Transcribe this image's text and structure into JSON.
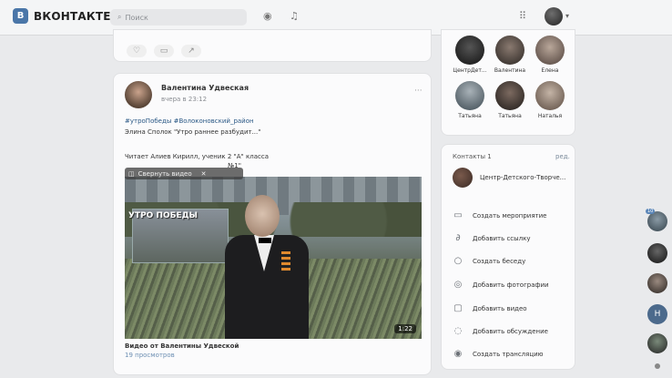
{
  "header": {
    "logo_text": "ВКОНТАКТЕ",
    "logo_mark": "В",
    "search_placeholder": "Поиск"
  },
  "reactions": [
    "like-icon",
    "comment-icon",
    "share-icon"
  ],
  "post": {
    "author": "Валентина Удвеская",
    "time": "вчера в 23:12",
    "menu": "···",
    "hashtags": "#утроПобеды #Волоконовский_район",
    "poem_line": "Элина Сполок \"Утро раннее разбудит...\"",
    "reader_line": "Читает Алиев Кирилл, ученик 2 \"А\" класса",
    "number_suffix": "№1\"",
    "video_toolbar_label": "Свернуть видео",
    "video_inset_label": "УТРО ПОБЕДЫ",
    "video_duration": "1:22",
    "video_caption": "Видео от Валентины Удвеской",
    "video_views": "19 просмотров"
  },
  "friends_row1": [
    "ЦентрДет...",
    "Валентина",
    "Елена"
  ],
  "friends_row2": [
    "Татьяна",
    "Татьяна",
    "Наталья"
  ],
  "contacts": {
    "title": "Контакты 1",
    "count": "ред.",
    "community_name": "Центр-Детского-Творче..."
  },
  "actions": [
    {
      "icon": "calendar-icon",
      "glyph": "▭",
      "label": "Создать мероприятие"
    },
    {
      "icon": "link-icon",
      "glyph": "∂",
      "label": "Добавить ссылку"
    },
    {
      "icon": "chat-icon",
      "glyph": "○",
      "label": "Создать беседу"
    },
    {
      "icon": "camera-icon",
      "glyph": "◎",
      "label": "Добавить фотографии"
    },
    {
      "icon": "video-icon",
      "glyph": "▢",
      "label": "Добавить видео"
    },
    {
      "icon": "discussion-icon",
      "glyph": "◌",
      "label": "Добавить обсуждение"
    },
    {
      "icon": "broadcast-icon",
      "glyph": "◉",
      "label": "Создать трансляцию"
    }
  ],
  "right_rail": {
    "badge": "10",
    "letter_avatar": "Н"
  },
  "colors": {
    "brand": "#4a76a8",
    "background": "#e9eaec",
    "card": "#fbfbfc"
  }
}
